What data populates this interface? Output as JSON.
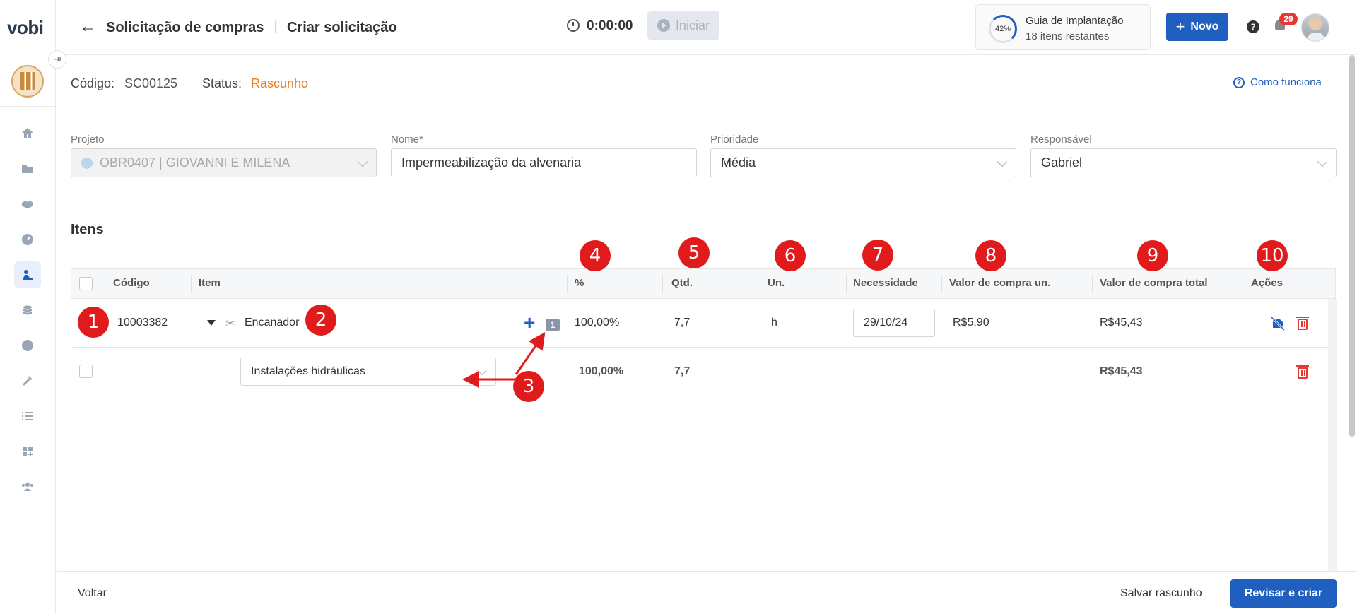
{
  "app": {
    "logo": "vobi"
  },
  "header": {
    "back_icon": "arrow-left-icon",
    "breadcrumb_1": "Solicitação de compras",
    "breadcrumb_separator": "|",
    "breadcrumb_2": "Criar solicitação",
    "timer": "0:00:00",
    "start_label": "Iniciar",
    "guide": {
      "percent": "42%",
      "title": "Guia de Implantação",
      "subtitle": "18 itens restantes"
    },
    "new_label": "Novo",
    "help_icon": "?",
    "notifications_count": "29"
  },
  "sidebar": {
    "items": [
      "home-icon",
      "folder-icon",
      "handshake-icon",
      "gauge-icon",
      "construction-worker-icon",
      "coins-icon",
      "dollar-icon",
      "tools-icon",
      "list-icon",
      "apps-add-icon",
      "team-icon"
    ],
    "active_item": "construction-worker-icon"
  },
  "summary": {
    "code_label": "Código:",
    "code_value": "SC00125",
    "status_label": "Status:",
    "status_value": "Rascunho",
    "status_color": "#e67e22",
    "how_it_works": "Como funciona",
    "how_icon": "?"
  },
  "form": {
    "project": {
      "label": "Projeto",
      "value": "OBR0407 | GIOVANNI E MILENA"
    },
    "name": {
      "label": "Nome*",
      "value": "Impermeabilização da alvenaria"
    },
    "priority": {
      "label": "Prioridade",
      "value": "Média"
    },
    "responsible": {
      "label": "Responsável",
      "value": "Gabriel"
    }
  },
  "items_title": "Itens",
  "table": {
    "columns": [
      "Código",
      "Item",
      "%",
      "Qtd.",
      "Un.",
      "Necessidade",
      "Valor de compra un.",
      "Valor de compra total",
      "Ações"
    ],
    "rows": [
      {
        "code": "10003382",
        "item": "Encanador",
        "link_count": "1",
        "percent": "100,00%",
        "qty": "7,7",
        "unit": "h",
        "need_date": "29/10/24",
        "unit_value": "R$5,90",
        "total_value": "R$45,43"
      },
      {
        "category": "Instalações hidráulicas",
        "percent": "100,00%",
        "qty": "7,7",
        "total_value": "R$45,43"
      }
    ]
  },
  "annotations": [
    "1",
    "2",
    "3",
    "4",
    "5",
    "6",
    "7",
    "8",
    "9",
    "10"
  ],
  "footer": {
    "back": "Voltar",
    "save_draft": "Salvar rascunho",
    "review_create": "Revisar e criar"
  },
  "colors": {
    "primary": "#1f5fbf",
    "danger": "#e53935",
    "annotation": "#e11b1b"
  }
}
